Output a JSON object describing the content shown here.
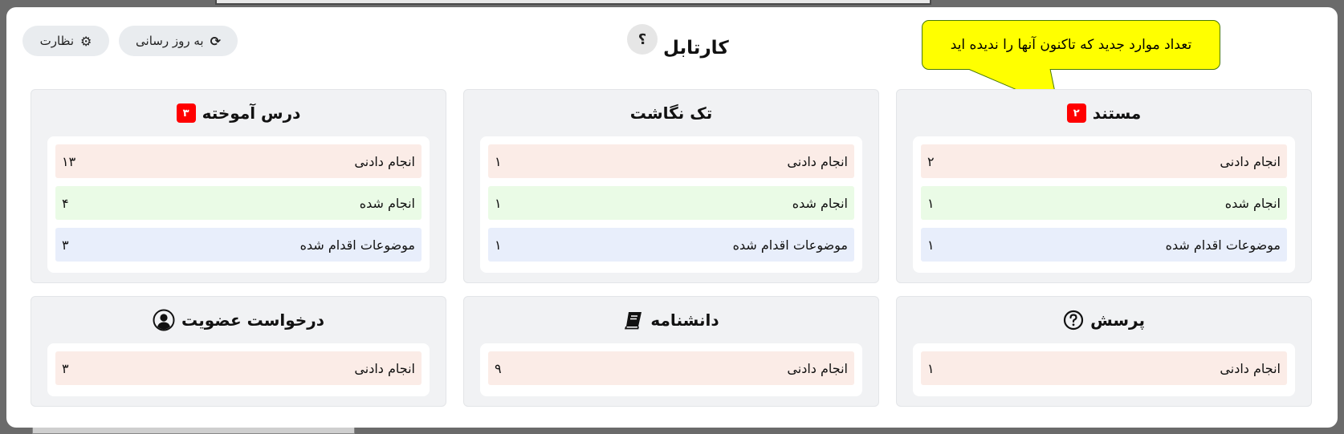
{
  "header": {
    "title": "کارتابل",
    "help_label": "؟",
    "refresh_label": "به روز رسانی",
    "monitor_label": "نظارت",
    "tooltip": "تعداد موارد جدید که تاکنون آنها را ندیده اید"
  },
  "cards": [
    {
      "title": "مستند",
      "badge": "۲",
      "rows": [
        {
          "label": "انجام دادنی",
          "value": "۲"
        },
        {
          "label": "انجام شده",
          "value": "۱"
        },
        {
          "label": "موضوعات اقدام شده",
          "value": "۱"
        }
      ]
    },
    {
      "title": "تک نگاشت",
      "rows": [
        {
          "label": "انجام دادنی",
          "value": "۱"
        },
        {
          "label": "انجام شده",
          "value": "۱"
        },
        {
          "label": "موضوعات اقدام شده",
          "value": "۱"
        }
      ]
    },
    {
      "title": "درس آموخته",
      "badge": "۳",
      "rows": [
        {
          "label": "انجام دادنی",
          "value": "۱۳"
        },
        {
          "label": "انجام شده",
          "value": "۴"
        },
        {
          "label": "موضوعات اقدام شده",
          "value": "۳"
        }
      ]
    },
    {
      "title": "پرسش",
      "icon": "question-circle-icon",
      "rows": [
        {
          "label": "انجام دادنی",
          "value": "۱"
        }
      ]
    },
    {
      "title": "دانشنامه",
      "icon": "book-icon",
      "rows": [
        {
          "label": "انجام دادنی",
          "value": "۹"
        }
      ]
    },
    {
      "title": "درخواست عضویت",
      "icon": "user-circle-icon",
      "rows": [
        {
          "label": "انجام دادنی",
          "value": "۳"
        }
      ]
    }
  ],
  "colors": {
    "pending": "#fbece7",
    "done": "#eafbe6",
    "actioned": "#e8eefb",
    "badge": "#ff0000",
    "tooltip": "#ffff00"
  },
  "icons": {
    "refresh": "refresh-icon",
    "monitor": "gear-icon"
  }
}
